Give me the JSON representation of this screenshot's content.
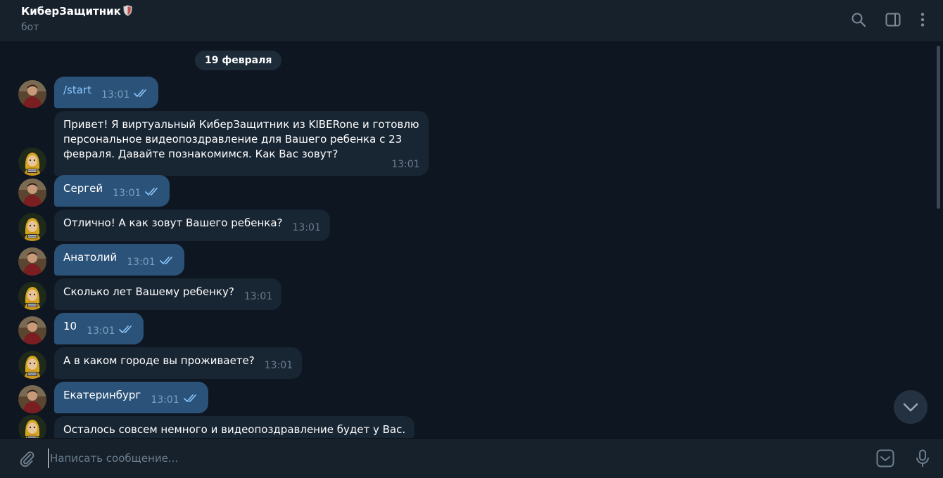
{
  "header": {
    "title": "КиберЗащитник",
    "subtitle": "бот"
  },
  "date": "19 февраля",
  "messages": [
    {
      "direction": "out",
      "text": "/start",
      "time": "13:01",
      "command": true
    },
    {
      "direction": "in",
      "text": "Привет! Я виртуальный КиберЗащитник из KIBERone и готовлю\nперсональное видеопоздравление для Вашего ребенка с 23\nфевраля. Давайте познакомимся. Как Вас зовут?",
      "time": "13:01"
    },
    {
      "direction": "out",
      "text": "Сергей",
      "time": "13:01"
    },
    {
      "direction": "in",
      "text": "Отлично! А как зовут Вашего ребенка?",
      "time": "13:01"
    },
    {
      "direction": "out",
      "text": "Анатолий",
      "time": "13:01"
    },
    {
      "direction": "in",
      "text": "Сколько лет Вашему ребенку?",
      "time": "13:01"
    },
    {
      "direction": "out",
      "text": "10",
      "time": "13:01"
    },
    {
      "direction": "in",
      "text": "А в каком городе вы проживаете?",
      "time": "13:01"
    },
    {
      "direction": "out",
      "text": "Екатеринбург",
      "time": "13:01"
    },
    {
      "direction": "in",
      "text": "Осталось совсем немного и видеопоздравление будет у Вас.",
      "time": ""
    }
  ],
  "composer": {
    "placeholder": "Написать сообщение..."
  },
  "icons": {
    "header": [
      "search-icon",
      "sidebar-toggle-icon",
      "more-vertical-icon"
    ],
    "composer": [
      "attach-icon",
      "emoji-sticker-icon",
      "microphone-icon"
    ],
    "scroll": "chevron-down-icon"
  },
  "colors": {
    "background": "#0e1621",
    "header": "#17212b",
    "outgoing_bubble": "#2b5278",
    "incoming_bubble": "#182533",
    "accent": "#8cc8ff"
  }
}
